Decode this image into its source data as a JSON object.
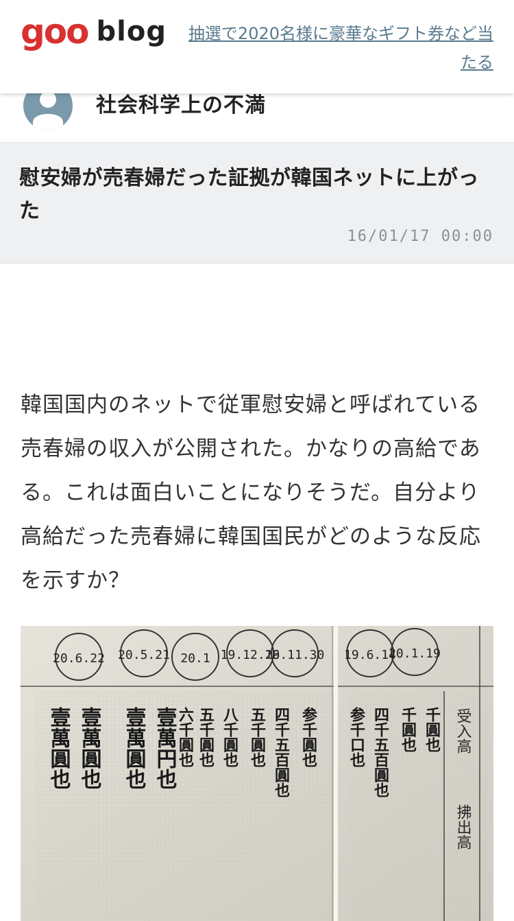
{
  "header": {
    "logo_goo": "goo",
    "logo_blog": "blog",
    "promo_text": "抽選で2020名様に豪華なギフト券など当たる",
    "brand_color": "#d93030",
    "link_color": "#5a7a8e"
  },
  "blog": {
    "name": "社会科学上の不満",
    "avatar_icon": "user-avatar-icon"
  },
  "post": {
    "title": "慰安婦が売春婦だった証拠が韓国ネットに上がった",
    "date": "16/01/17 00:00",
    "body": "韓国国内のネットで従軍慰安婦と呼ばれている売春婦の収入が公開された。かなりの高給である。これは面白いことになりそうだ。自分より高給だった売春婦に韓国国民がどのような反応を示すか？",
    "image": {
      "stamps": [
        "20.6.22",
        "20.5.21",
        "20.1",
        "19.12.26",
        "19.11.30",
        "19.6.14",
        "20.1.19"
      ],
      "column_texts": [
        "壹萬圓也",
        "壹萬圓也",
        "壹萬圓也",
        "壹萬円也",
        "六千圓也",
        "五千圓也",
        "八千圓也",
        "五千圓也",
        "四千五百圓也",
        "参千圓也",
        "参千口也",
        "四千五百圓也",
        "千圓也",
        "千圓也"
      ],
      "side_labels": [
        "受入高",
        "拂出高"
      ]
    }
  }
}
